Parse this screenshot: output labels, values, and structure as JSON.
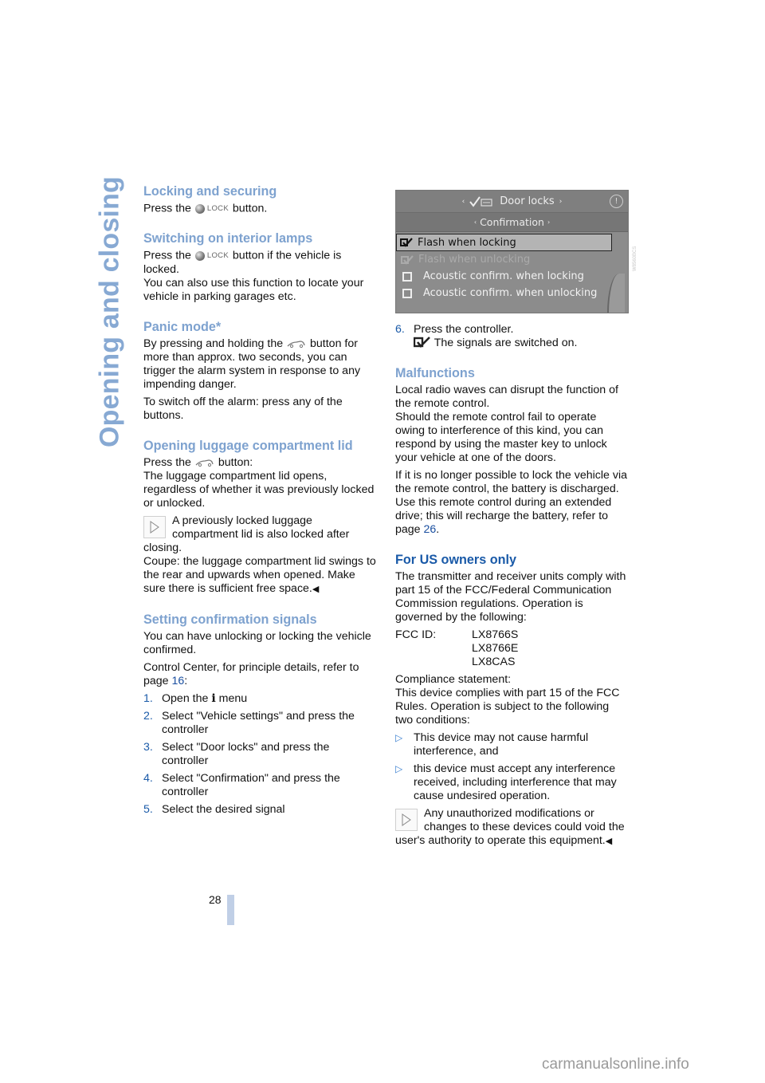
{
  "side_title": "Opening and closing",
  "page_number": "28",
  "watermark": "carmanualsonline.info",
  "image_code": "W8560BCS",
  "left_column": {
    "locking": {
      "heading": "Locking and securing",
      "text_before": "Press the",
      "lock_label": "LOCK",
      "text_after": "button."
    },
    "interior_lamps": {
      "heading": "Switching on interior lamps",
      "text_before": "Press the",
      "lock_label": "LOCK",
      "text_after": "button if the vehicle is locked.",
      "text2": "You can also use this function to locate your vehicle in parking garages etc."
    },
    "panic": {
      "heading": "Panic mode*",
      "text_before": "By pressing and holding the",
      "text_after": "button for more than approx. two seconds, you can trigger the alarm system in response to any impending danger.",
      "text2": "To switch off the alarm: press any of the buttons."
    },
    "luggage": {
      "heading": "Opening luggage compartment lid",
      "text_before": "Press the",
      "text_after": "button:",
      "text2": "The luggage compartment lid opens, regardless of whether it was previously locked or unlocked.",
      "note": "A previously locked luggage compartment lid is also locked after closing.",
      "note2": "Coupe: the luggage compartment lid swings to the rear and upwards when opened. Make sure there is sufficient free space.",
      "end_mark": "◀"
    },
    "confirmation": {
      "heading": "Setting confirmation signals",
      "text1": "You can have unlocking or locking the vehicle confirmed.",
      "text2_before": "Control Center, for principle details, refer to page",
      "text2_page": "16",
      "text2_after": ":",
      "steps": [
        {
          "num": "1.",
          "before": "Open the",
          "icon": "i",
          "after": "menu"
        },
        {
          "num": "2.",
          "text": "Select \"Vehicle settings\" and press the controller"
        },
        {
          "num": "3.",
          "text": "Select \"Door locks\" and press the controller"
        },
        {
          "num": "4.",
          "text": "Select \"Confirmation\" and press the controller"
        },
        {
          "num": "5.",
          "text": "Select the desired signal"
        }
      ]
    }
  },
  "screen": {
    "title": "Door locks",
    "subtitle": "Confirmation",
    "items": [
      {
        "label": "Flash when locking",
        "checked": true,
        "state": "selected"
      },
      {
        "label": "Flash when unlocking",
        "checked": true,
        "state": "disabled"
      },
      {
        "label": "Acoustic confirm. when locking",
        "checked": false,
        "state": "normal"
      },
      {
        "label": "Acoustic confirm. when unlocking",
        "checked": false,
        "state": "normal"
      }
    ]
  },
  "right_column": {
    "step6": {
      "num": "6.",
      "text": "Press the controller.",
      "result": "The signals are switched on."
    },
    "malfunctions": {
      "heading": "Malfunctions",
      "text1": "Local radio waves can disrupt the function of the remote control.",
      "text2": "Should the remote control fail to operate owing to interference of this kind, you can respond by using the master key to unlock your vehicle at one of the doors.",
      "text3_before": "If it is no longer possible to lock the vehicle via the remote control, the battery is discharged. Use this remote control during an extended drive; this will recharge the battery, refer to page",
      "text3_page": "26",
      "text3_after": "."
    },
    "us_owners": {
      "heading": "For US owners only",
      "text1": "The transmitter and receiver units comply with part 15 of the FCC/Federal Communication Commission regulations. Operation is governed by the following:",
      "fcc_label": "FCC ID:",
      "fcc_ids": [
        "LX8766S",
        "LX8766E",
        "LX8CAS"
      ],
      "compliance_title": "Compliance statement:",
      "compliance_text": "This device complies with part 15 of the FCC Rules. Operation is subject to the following two conditions:",
      "conditions": [
        "This device may not cause harmful interference, and",
        "this device must accept any interference received, including interference that may cause undesired operation."
      ],
      "note": "Any unauthorized modifications or changes to these devices could void the user's authority to operate this equipment.",
      "end_mark": "◀"
    }
  }
}
